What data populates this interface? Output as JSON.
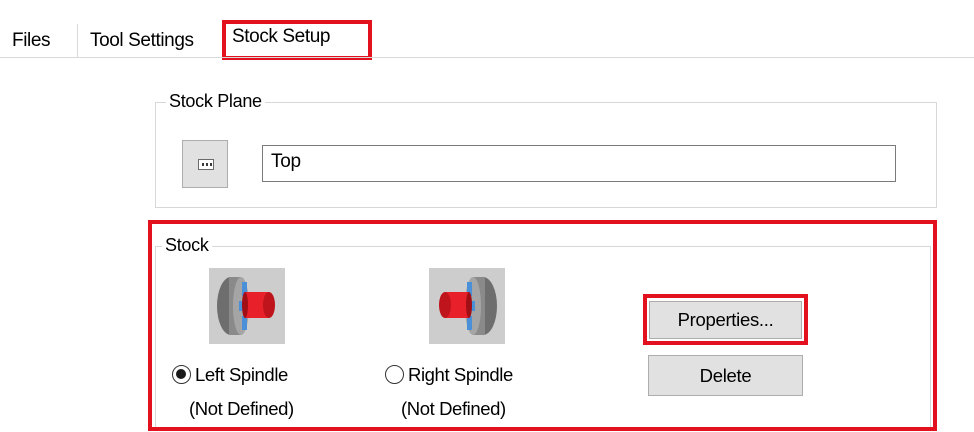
{
  "tabs": [
    {
      "label": "Files"
    },
    {
      "label": "Tool Settings"
    },
    {
      "label": "Stock Setup",
      "active": true
    }
  ],
  "stock_plane": {
    "legend": "Stock Plane",
    "button_icon": "plane-select-icon",
    "value": "Top"
  },
  "stock": {
    "legend": "Stock",
    "left_spindle": {
      "label": "Left Spindle",
      "status": "(Not Defined)",
      "selected": true,
      "icon": "left-spindle-icon"
    },
    "right_spindle": {
      "label": "Right Spindle",
      "status": "(Not Defined)",
      "selected": false,
      "icon": "right-spindle-icon"
    },
    "properties_label": "Properties...",
    "delete_label": "Delete"
  },
  "colors": {
    "highlight": "#e3101e",
    "button_face": "#e1e1e1",
    "spindle_red": "#e8202a",
    "spindle_blue": "#4a90d9"
  }
}
